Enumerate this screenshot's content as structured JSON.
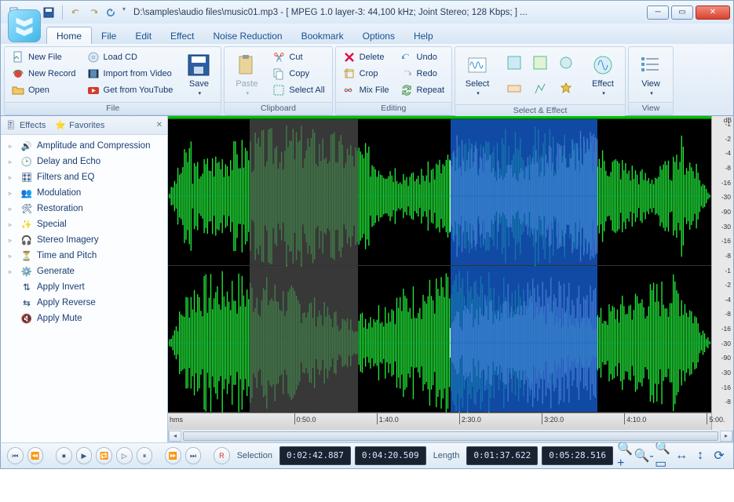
{
  "title": "D:\\samples\\audio files\\music01.mp3 - [ MPEG 1.0 layer-3: 44,100 kHz; Joint Stereo; 128 Kbps;  ] ...",
  "menu": {
    "tabs": [
      "Home",
      "File",
      "Edit",
      "Effect",
      "Noise Reduction",
      "Bookmark",
      "Options",
      "Help"
    ],
    "active": "Home"
  },
  "ribbon": {
    "file": {
      "label": "File",
      "new": "New File",
      "record": "New Record",
      "open": "Open",
      "loadcd": "Load CD",
      "import": "Import from Video",
      "youtube": "Get from YouTube",
      "save": "Save"
    },
    "clipboard": {
      "label": "Clipboard",
      "paste": "Paste",
      "cut": "Cut",
      "copy": "Copy",
      "selectall": "Select All"
    },
    "editing": {
      "label": "Editing",
      "delete": "Delete",
      "crop": "Crop",
      "mix": "Mix File",
      "undo": "Undo",
      "redo": "Redo",
      "repeat": "Repeat"
    },
    "select": {
      "label": "Select & Effect",
      "selectbtn": "Select",
      "effectbtn": "Effect"
    },
    "view": {
      "label": "View",
      "viewbtn": "View"
    }
  },
  "sidebar": {
    "tabs": {
      "effects": "Effects",
      "favorites": "Favorites"
    },
    "items": [
      "Amplitude and Compression",
      "Delay and Echo",
      "Filters and EQ",
      "Modulation",
      "Restoration",
      "Special",
      "Stereo Imagery",
      "Time and Pitch",
      "Generate",
      "Apply Invert",
      "Apply Reverse",
      "Apply Mute"
    ]
  },
  "timeline": {
    "unit": "hms",
    "ticks": [
      "0:50.0",
      "1:40.0",
      "2:30.0",
      "3:20.0",
      "4:10.0",
      "5:00."
    ]
  },
  "db": {
    "header": "dB",
    "marks": [
      "-1",
      "-2",
      "-4",
      "-8",
      "-16",
      "-30",
      "-90",
      "-30",
      "-16",
      "-8"
    ]
  },
  "status": {
    "sel_label": "Selection",
    "sel_start": "0:02:42.887",
    "sel_end": "0:04:20.509",
    "len_label": "Length",
    "len_a": "0:01:37.622",
    "len_b": "0:05:28.516",
    "rec": "R"
  }
}
